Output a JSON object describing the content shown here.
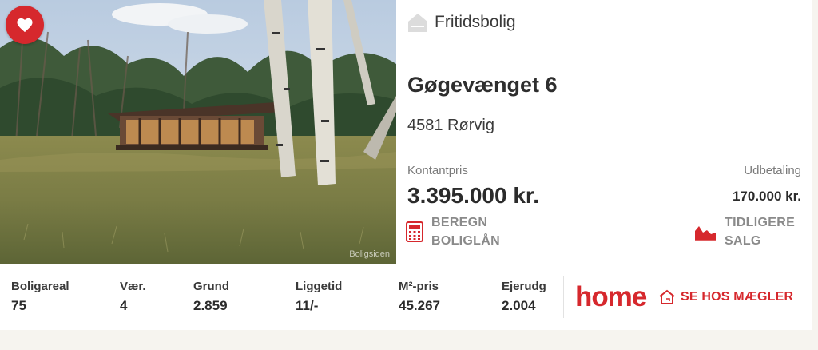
{
  "listing": {
    "type_icon": "house-icon",
    "type": "Fritidsbolig",
    "address": "Gøgevænget 6",
    "city": "4581 Rørvig",
    "cash_price_label": "Kontantpris",
    "cash_price": "3.395.000 kr.",
    "down_payment_label": "Udbetaling",
    "down_payment": "170.000 kr.",
    "favorite_icon": "heart-icon",
    "photo_watermark": "Boligsiden"
  },
  "actions": {
    "calc_icon": "calculator-icon",
    "calc_line1": "BEREGN",
    "calc_line2": "BOLIGLÅN",
    "history_icon": "area-chart-icon",
    "history_line1": "TIDLIGERE",
    "history_line2": "SALG"
  },
  "stats": [
    {
      "label": "Boligareal",
      "value": "75"
    },
    {
      "label": "Vær.",
      "value": "4"
    },
    {
      "label": "Grund",
      "value": "2.859"
    },
    {
      "label": "Liggetid",
      "value": "11/-"
    },
    {
      "label": "M²-pris",
      "value": "45.267"
    },
    {
      "label": "Ejerudg",
      "value": "2.004"
    }
  ],
  "broker": {
    "logo_text": "home",
    "cta_icon": "house-outline-icon",
    "cta": "SE HOS MÆGLER"
  },
  "colors": {
    "accent_red": "#d6282d",
    "muted_gray": "#8a8a8a",
    "background": "#f6f4ef"
  }
}
